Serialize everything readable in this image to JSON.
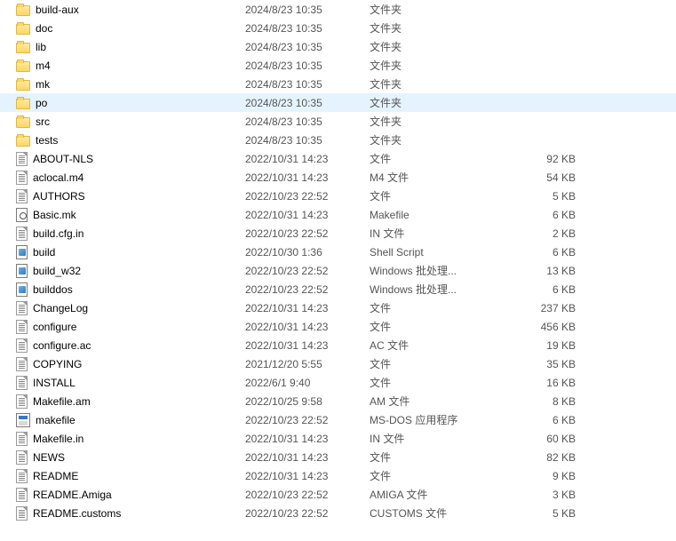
{
  "items": [
    {
      "name": "build-aux",
      "date": "2024/8/23 10:35",
      "type": "文件夹",
      "size": "",
      "icon": "folder",
      "selected": false
    },
    {
      "name": "doc",
      "date": "2024/8/23 10:35",
      "type": "文件夹",
      "size": "",
      "icon": "folder",
      "selected": false
    },
    {
      "name": "lib",
      "date": "2024/8/23 10:35",
      "type": "文件夹",
      "size": "",
      "icon": "folder",
      "selected": false
    },
    {
      "name": "m4",
      "date": "2024/8/23 10:35",
      "type": "文件夹",
      "size": "",
      "icon": "folder",
      "selected": false
    },
    {
      "name": "mk",
      "date": "2024/8/23 10:35",
      "type": "文件夹",
      "size": "",
      "icon": "folder",
      "selected": false
    },
    {
      "name": "po",
      "date": "2024/8/23 10:35",
      "type": "文件夹",
      "size": "",
      "icon": "folder",
      "selected": true
    },
    {
      "name": "src",
      "date": "2024/8/23 10:35",
      "type": "文件夹",
      "size": "",
      "icon": "folder",
      "selected": false
    },
    {
      "name": "tests",
      "date": "2024/8/23 10:35",
      "type": "文件夹",
      "size": "",
      "icon": "folder",
      "selected": false
    },
    {
      "name": "ABOUT-NLS",
      "date": "2022/10/31 14:23",
      "type": "文件",
      "size": "92 KB",
      "icon": "file",
      "selected": false
    },
    {
      "name": "aclocal.m4",
      "date": "2022/10/31 14:23",
      "type": "M4 文件",
      "size": "54 KB",
      "icon": "file",
      "selected": false
    },
    {
      "name": "AUTHORS",
      "date": "2022/10/23 22:52",
      "type": "文件",
      "size": "5 KB",
      "icon": "file",
      "selected": false
    },
    {
      "name": "Basic.mk",
      "date": "2022/10/31 14:23",
      "type": "Makefile",
      "size": "6 KB",
      "icon": "config",
      "selected": false
    },
    {
      "name": "build.cfg.in",
      "date": "2022/10/23 22:52",
      "type": "IN 文件",
      "size": "2 KB",
      "icon": "file",
      "selected": false
    },
    {
      "name": "build",
      "date": "2022/10/30 1:36",
      "type": "Shell Script",
      "size": "6 KB",
      "icon": "script",
      "selected": false
    },
    {
      "name": "build_w32",
      "date": "2022/10/23 22:52",
      "type": "Windows 批处理...",
      "size": "13 KB",
      "icon": "script",
      "selected": false
    },
    {
      "name": "builddos",
      "date": "2022/10/23 22:52",
      "type": "Windows 批处理...",
      "size": "6 KB",
      "icon": "script",
      "selected": false
    },
    {
      "name": "ChangeLog",
      "date": "2022/10/31 14:23",
      "type": "文件",
      "size": "237 KB",
      "icon": "file",
      "selected": false
    },
    {
      "name": "configure",
      "date": "2022/10/31 14:23",
      "type": "文件",
      "size": "456 KB",
      "icon": "file",
      "selected": false
    },
    {
      "name": "configure.ac",
      "date": "2022/10/31 14:23",
      "type": "AC 文件",
      "size": "19 KB",
      "icon": "file",
      "selected": false
    },
    {
      "name": "COPYING",
      "date": "2021/12/20 5:55",
      "type": "文件",
      "size": "35 KB",
      "icon": "file",
      "selected": false
    },
    {
      "name": "INSTALL",
      "date": "2022/6/1 9:40",
      "type": "文件",
      "size": "16 KB",
      "icon": "file",
      "selected": false
    },
    {
      "name": "Makefile.am",
      "date": "2022/10/25 9:58",
      "type": "AM 文件",
      "size": "8 KB",
      "icon": "file",
      "selected": false
    },
    {
      "name": "makefile",
      "date": "2022/10/23 22:52",
      "type": "MS-DOS 应用程序",
      "size": "6 KB",
      "icon": "exe",
      "selected": false
    },
    {
      "name": "Makefile.in",
      "date": "2022/10/31 14:23",
      "type": "IN 文件",
      "size": "60 KB",
      "icon": "file",
      "selected": false
    },
    {
      "name": "NEWS",
      "date": "2022/10/31 14:23",
      "type": "文件",
      "size": "82 KB",
      "icon": "file",
      "selected": false
    },
    {
      "name": "README",
      "date": "2022/10/31 14:23",
      "type": "文件",
      "size": "9 KB",
      "icon": "file",
      "selected": false
    },
    {
      "name": "README.Amiga",
      "date": "2022/10/23 22:52",
      "type": "AMIGA 文件",
      "size": "3 KB",
      "icon": "file",
      "selected": false
    },
    {
      "name": "README.customs",
      "date": "2022/10/23 22:52",
      "type": "CUSTOMS 文件",
      "size": "5 KB",
      "icon": "file",
      "selected": false
    }
  ]
}
